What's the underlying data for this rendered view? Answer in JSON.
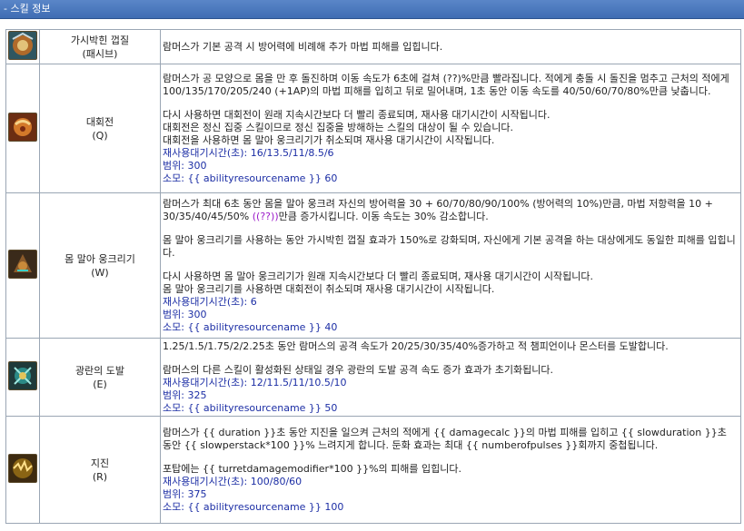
{
  "header": {
    "title": "- 스킬 정보"
  },
  "skills": [
    {
      "icon": "armor-shell-icon",
      "name": "가시박힌 껍질",
      "key": "(패시브)",
      "desc": [
        "람머스가 기본 공격 시 방어력에 비례해 추가 마법 피해를 입힙니다."
      ],
      "stats": []
    },
    {
      "icon": "rolling-ball-icon",
      "name": "대회전",
      "key": "(Q)",
      "desc": [
        "람머스가 공 모양으로 몸을 만 후 돌진하며 이동 속도가 6초에 걸쳐 (??)%만큼 빨라집니다. 적에게 충돌 시 돌진을 멈추고 근처의 적에게 100/135/170/205/240 (+1AP)의 마법 피해를 입히고 뒤로 밀어내며, 1초 동안 이동 속도를 40/50/60/70/80%만큼 낮춥니다.",
        "",
        "다시 사용하면 대회전이 원래 지속시간보다 더 빨리 종료되며, 재사용 대기시간이 시작됩니다.",
        "대회전은 정신 집중 스킬이므로 정신 집중을 방해하는 스킬의 대상이 될 수 있습니다.",
        "대회전을 사용하면 몸 말아 웅크리기가 취소되며 재사용 대기시간이 시작됩니다."
      ],
      "stats": [
        "재사용대기시간(초): 16/13.5/11/8.5/6",
        "범위: 300",
        "소모: {{ abilityresourcename }} 60"
      ]
    },
    {
      "icon": "defensive-curl-icon",
      "name": "몸 말아 웅크리기",
      "key": "(W)",
      "desc_pre": "람머스가 최대 6초 동안 몸을 말아 웅크려 자신의 방어력을 30 + 60/70/80/90/100% (방어력의 10%)만큼, 마법 저항력을 10 + 30/35/40/45/50% ",
      "desc_purple": "((??))",
      "desc_post": "만큼 증가시킵니다. 이동 속도는 30% 감소합니다.",
      "desc": [
        "",
        "몸 말아 웅크리기를 사용하는 동안 가시박힌 껍질 효과가 150%로 강화되며, 자신에게 기본 공격을 하는 대상에게도 동일한 피해를 입힙니다.",
        "",
        "다시 사용하면 몸 말아 웅크리기가 원래 지속시간보다 더 빨리 종료되며, 재사용 대기시간이 시작됩니다.",
        "몸 말아 웅크리기를 사용하면 대회전이 취소되며 재사용 대기시간이 시작됩니다."
      ],
      "stats": [
        "재사용대기시간(초): 6",
        "범위: 300",
        "소모: {{ abilityresourcename }} 40"
      ]
    },
    {
      "icon": "frenzying-taunt-icon",
      "name": "광란의 도발",
      "key": "(E)",
      "desc": [
        "1.25/1.5/1.75/2/2.25초 동안 람머스의 공격 속도가 20/25/30/35/40%증가하고 적 챔피언이나 몬스터를 도발합니다.",
        "",
        "람머스의 다른 스킬이 활성화된 상태일 경우 광란의 도발 공격 속도 증가 효과가 초기화됩니다."
      ],
      "stats": [
        "재사용대기시간(초): 12/11.5/11/10.5/10",
        "범위: 325",
        "소모: {{ abilityresourcename }} 50"
      ]
    },
    {
      "icon": "tremors-icon",
      "name": "지진",
      "key": "(R)",
      "desc": [
        "람머스가 {{ duration }}초 동안 지진을 일으켜 근처의 적에게 {{ damagecalc }}의 마법 피해를 입히고 {{ slowduration }}초 동안 {{ slowperstack*100 }}% 느려지게 합니다. 둔화 효과는 최대 {{ numberofpulses }}회까지 중첩됩니다.",
        "",
        "포탑에는 {{ turretdamagemodifier*100 }}%의 피해를 입힙니다."
      ],
      "stats": [
        "재사용대기시간(초): 100/80/60",
        "범위: 375",
        "소모: {{ abilityresourcename }} 100"
      ]
    }
  ]
}
